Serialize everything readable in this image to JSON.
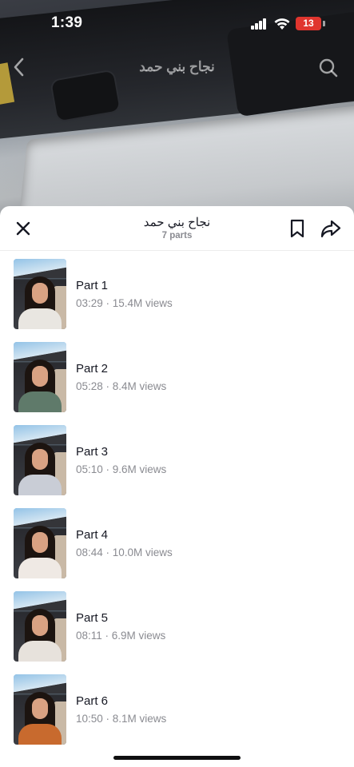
{
  "status": {
    "time": "1:39",
    "battery": "13"
  },
  "video": {
    "title": "نجاح بني حمد"
  },
  "playlist": {
    "title": "نجاح بني حمد",
    "count": "7 parts",
    "parts": [
      {
        "title": "Part 1",
        "meta": "03:29 · 15.4M views",
        "outfit": "#e9e6e1"
      },
      {
        "title": "Part 2",
        "meta": "05:28 · 8.4M views",
        "outfit": "#5f7a6a"
      },
      {
        "title": "Part 3",
        "meta": "05:10 · 9.6M views",
        "outfit": "#c9cdd6"
      },
      {
        "title": "Part 4",
        "meta": "08:44 · 10.0M views",
        "outfit": "#efe9e4"
      },
      {
        "title": "Part 5",
        "meta": "08:11 · 6.9M views",
        "outfit": "#e7e2dc"
      },
      {
        "title": "Part 6",
        "meta": "10:50 · 8.1M views",
        "outfit": "#c86a2e"
      }
    ]
  },
  "icons": {
    "back": "back-icon",
    "search": "search-icon",
    "close": "close-icon",
    "bookmark": "bookmark-icon",
    "share": "share-icon"
  }
}
